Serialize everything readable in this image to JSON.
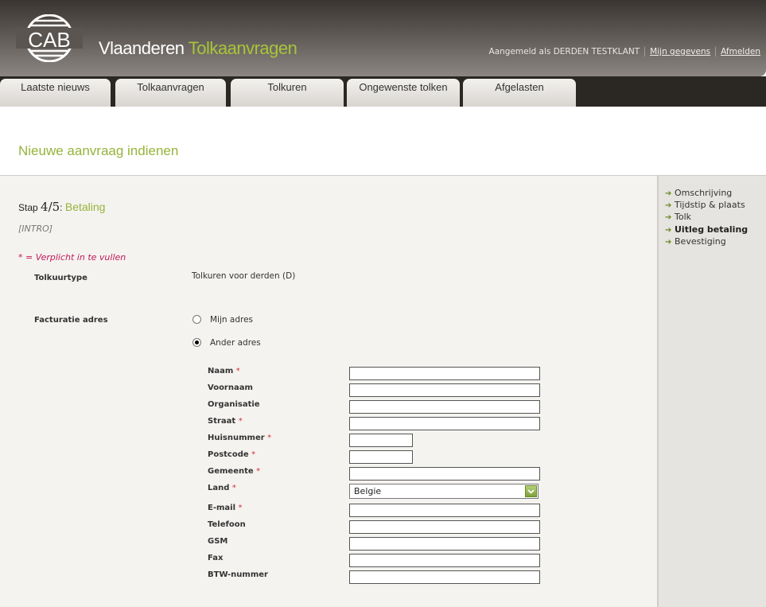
{
  "header": {
    "logo_text": "CAB",
    "brand_main": "Vlaanderen",
    "brand_accent": "Tolkaanvragen",
    "logged_in_prefix": "Aangemeld als",
    "user_name": "DERDEN TESTKLANT",
    "my_data_link": "Mijn gegevens",
    "logout_link": "Afmelden"
  },
  "tabs": [
    {
      "label": "Laatste nieuws"
    },
    {
      "label": "Tolkaanvragen"
    },
    {
      "label": "Tolkuren"
    },
    {
      "label": "Ongewenste tolken"
    },
    {
      "label": "Afgelasten"
    }
  ],
  "page": {
    "title": "Nieuwe aanvraag indienen",
    "step_prefix": "Stap",
    "step_number": "4/5",
    "step_colon": ":",
    "step_name": "Betaling",
    "intro": "[INTRO]",
    "required_note": "* = Verplicht in te vullen"
  },
  "form": {
    "tolkuurtype_label": "Tolkuurtype",
    "tolkuurtype_value": "Tolkuren voor derden (D)",
    "facturatie_label": "Facturatie adres",
    "radio_own": "Mijn adres",
    "radio_other": "Ander adres",
    "radio_selected": "Ander adres",
    "required_mark": "*",
    "fields": [
      {
        "label": "Naam",
        "required": true,
        "value": ""
      },
      {
        "label": "Voornaam",
        "required": false,
        "value": ""
      },
      {
        "label": "Organisatie",
        "required": false,
        "value": ""
      },
      {
        "label": "Straat",
        "required": true,
        "value": ""
      },
      {
        "label": "Huisnummer",
        "required": true,
        "value": ""
      },
      {
        "label": "Postcode",
        "required": true,
        "value": ""
      },
      {
        "label": "Gemeente",
        "required": true,
        "value": ""
      },
      {
        "label": "Land",
        "required": true,
        "value": "Belgie"
      },
      {
        "label": "E-mail",
        "required": true,
        "value": ""
      },
      {
        "label": "Telefoon",
        "required": false,
        "value": ""
      },
      {
        "label": "GSM",
        "required": false,
        "value": ""
      },
      {
        "label": "Fax",
        "required": false,
        "value": ""
      },
      {
        "label": "BTW-nummer",
        "required": false,
        "value": ""
      }
    ]
  },
  "sidebar": {
    "items": [
      {
        "label": "Omschrijving",
        "active": false
      },
      {
        "label": "Tijdstip & plaats",
        "active": false
      },
      {
        "label": "Tolk",
        "active": false
      },
      {
        "label": "Uitleg betaling",
        "active": true
      },
      {
        "label": "Bevestiging",
        "active": false
      }
    ]
  },
  "colors": {
    "accent_green": "#97b33a",
    "required_red": "#d0303a",
    "required_note_pink": "#c2185b"
  }
}
